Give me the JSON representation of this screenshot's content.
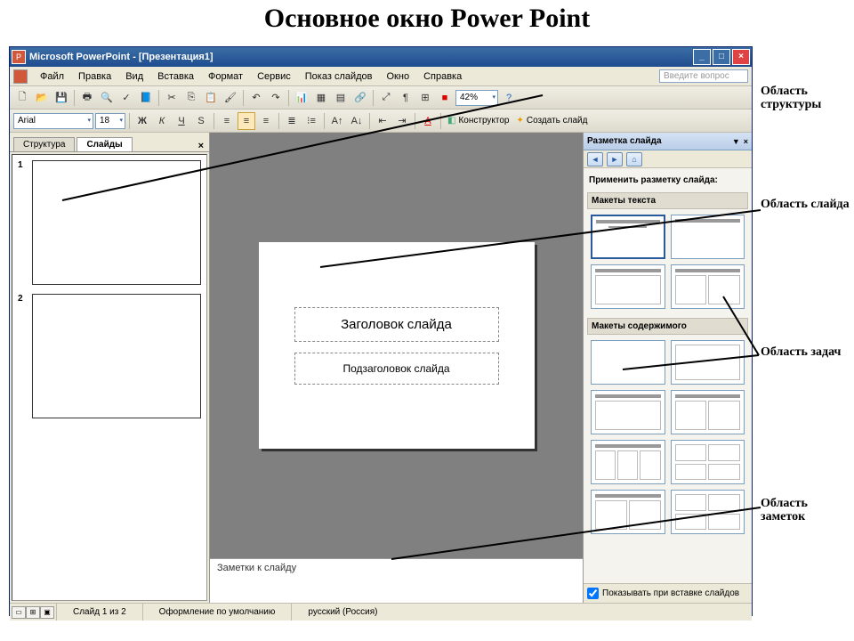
{
  "page": {
    "title": "Основное окно Power Point"
  },
  "titlebar": {
    "text": "Microsoft PowerPoint - [Презентация1]"
  },
  "menubar": {
    "items": [
      "Файл",
      "Правка",
      "Вид",
      "Вставка",
      "Формат",
      "Сервис",
      "Показ слайдов",
      "Окно",
      "Справка"
    ],
    "help_placeholder": "Введите вопрос"
  },
  "toolbar1": {
    "zoom": "42%"
  },
  "toolbar2": {
    "font": "Arial",
    "size": "18",
    "bold": "Ж",
    "italic": "К",
    "underline": "Ч",
    "shadow": "S",
    "designer": "Конструктор",
    "newslide": "Создать слайд"
  },
  "leftpane": {
    "tab_structure": "Структура",
    "tab_slides": "Слайды",
    "thumbs": [
      "1",
      "2"
    ]
  },
  "slide": {
    "title_ph": "Заголовок слайда",
    "subtitle_ph": "Подзаголовок слайда"
  },
  "notes": {
    "placeholder": "Заметки к слайду"
  },
  "taskpane": {
    "title": "Разметка слайда",
    "apply_label": "Применить разметку слайда:",
    "section_text": "Макеты текста",
    "section_content": "Макеты содержимого",
    "show_on_insert": "Показывать при вставке слайдов"
  },
  "statusbar": {
    "slide": "Слайд 1 из 2",
    "design": "Оформление по умолчанию",
    "lang": "русский (Россия)"
  },
  "annotations": {
    "structure": "Область структуры",
    "slide": "Область слайда",
    "taskpane": "Область задач",
    "notes": "Область заметок"
  }
}
